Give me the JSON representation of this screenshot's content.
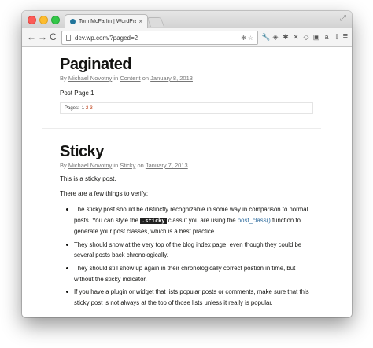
{
  "browser": {
    "tab_title": "Tom McFarlin | WordPress",
    "tab_close": "×",
    "url": "dev.wp.com/?paged=2",
    "back": "←",
    "forward": "→",
    "reload": "C",
    "menu": "≡",
    "fullscreen": "⤢",
    "extensions": [
      {
        "icon": "wrench-icon",
        "glyph": "🔧"
      },
      {
        "icon": "layers-icon",
        "glyph": "◈"
      },
      {
        "icon": "cog-icon",
        "glyph": "✱"
      },
      {
        "icon": "x-extension-icon",
        "glyph": "✕"
      },
      {
        "icon": "pocket-icon",
        "glyph": "◇"
      },
      {
        "icon": "window-icon",
        "glyph": "▣"
      },
      {
        "icon": "amazon-icon",
        "glyph": "a"
      },
      {
        "icon": "arrow-icon",
        "glyph": "⇩"
      }
    ]
  },
  "posts": [
    {
      "title": "Paginated",
      "meta": {
        "by": "By",
        "author": "Michael Novotny",
        "in": "in",
        "category": "Content",
        "on": "on",
        "date": "January 8, 2013"
      },
      "text": "Post Page 1",
      "pages": {
        "label": "Pages:",
        "current": "1",
        "links": [
          "2",
          "3"
        ]
      }
    },
    {
      "title": "Sticky",
      "meta": {
        "by": "By",
        "author": "Michael Novotny",
        "in": "in",
        "category": "Sticky",
        "on": "on",
        "date": "January 7, 2013"
      },
      "para1": "This is a sticky post.",
      "para2": "There are a few things to verify:",
      "bullets": [
        {
          "pre": "The sticky post should be distinctly recognizable in some way in comparison to normal posts. You can style the ",
          "code": ".sticky",
          "mid": " class if you are using the ",
          "link": "post_class()",
          "post": " function to generate your post classes, which is a best practice."
        },
        {
          "text": "They should show at the very top of the blog index page, even though they could be several posts back chronologically."
        },
        {
          "text": "They should still show up again in their chronologically correct postion in time, but without the sticky indicator."
        },
        {
          "text": "If you have a plugin or widget that lists popular posts or comments, make sure that this sticky post is not always at the top of those lists unless it really is popular."
        }
      ]
    }
  ]
}
